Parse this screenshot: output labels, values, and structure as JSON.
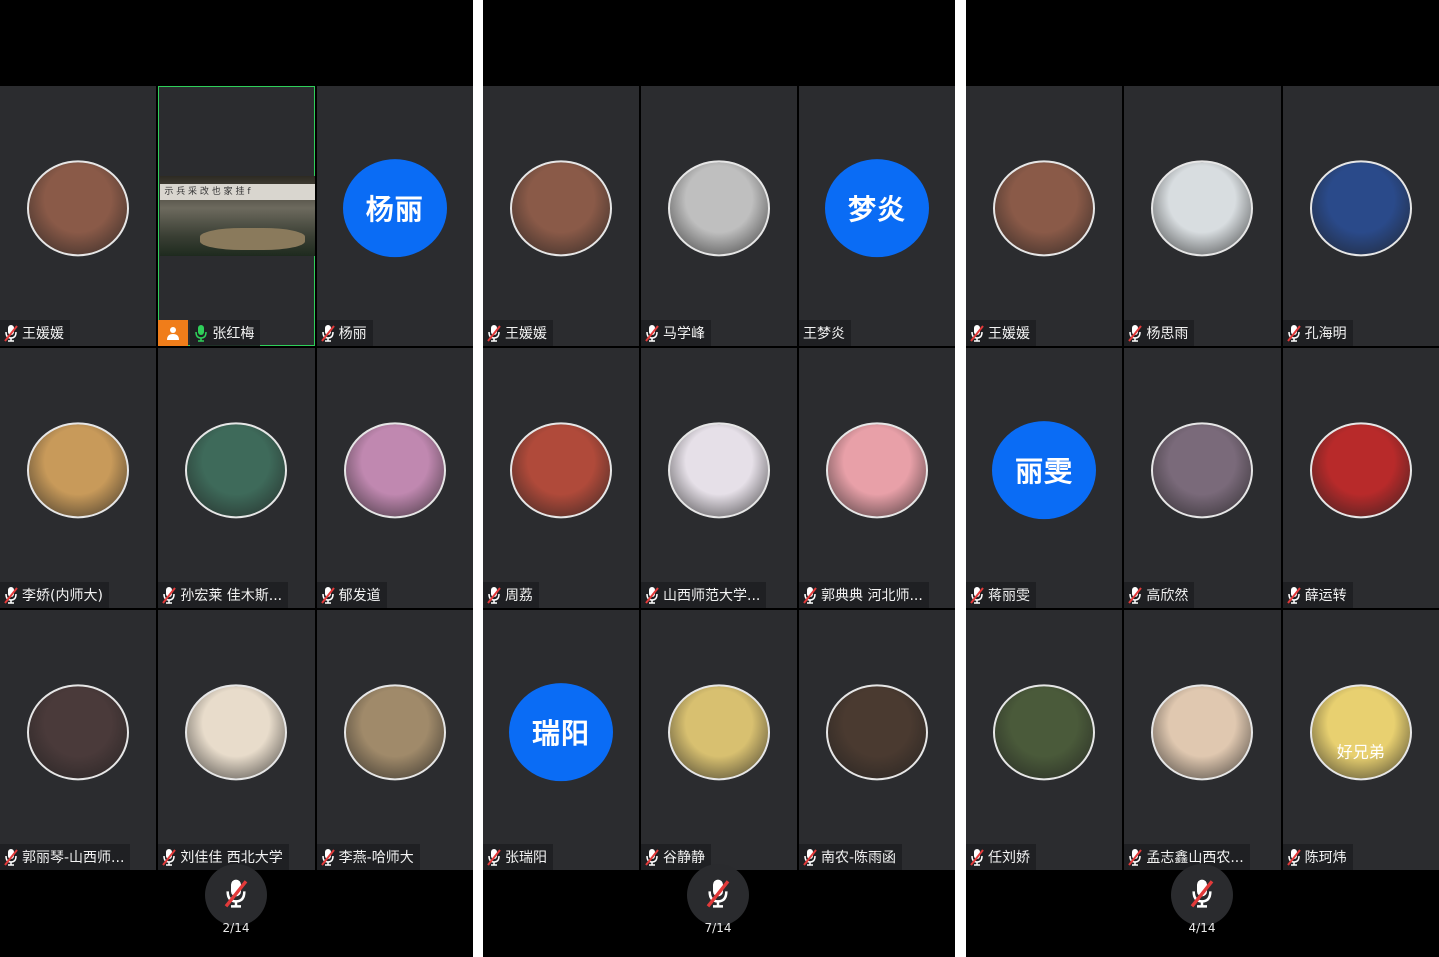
{
  "screens": [
    {
      "page": "2/14",
      "tiles": [
        {
          "name": "王媛媛",
          "mic": "muted",
          "avatar": "photo",
          "color": "#8a5a48"
        },
        {
          "name": "张红梅",
          "mic": "active",
          "avatar": "video",
          "host": true,
          "video_caption": "示 兵   采 改   也 家   挂 f"
        },
        {
          "name": "杨丽",
          "mic": "muted",
          "avatar": "text",
          "avatar_text": "杨丽"
        },
        {
          "name": "李娇(内师大)",
          "mic": "muted",
          "avatar": "photo",
          "color": "#c89a5a"
        },
        {
          "name": "孙宏莱 佳木斯...",
          "mic": "muted",
          "avatar": "photo",
          "color": "#3e6a5a"
        },
        {
          "name": "郁发道",
          "mic": "muted",
          "avatar": "photo",
          "color": "#c088b0"
        },
        {
          "name": "郭丽琴-山西师...",
          "mic": "muted",
          "avatar": "photo",
          "color": "#4a3a3a"
        },
        {
          "name": "刘佳佳 西北大学",
          "mic": "muted",
          "avatar": "photo",
          "color": "#e8dccb"
        },
        {
          "name": "李燕-哈师大",
          "mic": "muted",
          "avatar": "photo",
          "color": "#a08a6a"
        }
      ]
    },
    {
      "page": "7/14",
      "tiles": [
        {
          "name": "王媛媛",
          "mic": "muted",
          "avatar": "photo",
          "color": "#8a5a48"
        },
        {
          "name": "马学峰",
          "mic": "muted",
          "avatar": "photo",
          "color": "#bfbfbf"
        },
        {
          "name": "王梦炎",
          "mic": "none",
          "avatar": "text",
          "avatar_text": "梦炎"
        },
        {
          "name": "周荔",
          "mic": "muted",
          "avatar": "photo",
          "color": "#b04a3a"
        },
        {
          "name": "山西师范大学...",
          "mic": "muted",
          "avatar": "photo",
          "color": "#e6e0e8"
        },
        {
          "name": "郭典典 河北师...",
          "mic": "muted",
          "avatar": "photo",
          "color": "#e8a0a8"
        },
        {
          "name": "张瑞阳",
          "mic": "muted",
          "avatar": "text",
          "avatar_text": "瑞阳"
        },
        {
          "name": "谷静静",
          "mic": "muted",
          "avatar": "photo",
          "color": "#d8c070"
        },
        {
          "name": "南农-陈雨函",
          "mic": "muted",
          "avatar": "photo",
          "color": "#4a3a30"
        }
      ]
    },
    {
      "page": "4/14",
      "tiles": [
        {
          "name": "王媛媛",
          "mic": "muted",
          "avatar": "photo",
          "color": "#8a5a48"
        },
        {
          "name": "杨思雨",
          "mic": "muted",
          "avatar": "photo",
          "color": "#d8dde0"
        },
        {
          "name": "孔海明",
          "mic": "muted",
          "avatar": "photo",
          "color": "#2a4a8a"
        },
        {
          "name": "蒋丽雯",
          "mic": "muted",
          "avatar": "text",
          "avatar_text": "丽雯"
        },
        {
          "name": "高欣然",
          "mic": "muted",
          "avatar": "photo",
          "color": "#7a6a7a"
        },
        {
          "name": "薛运转",
          "mic": "muted",
          "avatar": "photo",
          "color": "#b82a2a"
        },
        {
          "name": "任刘娇",
          "mic": "muted",
          "avatar": "photo",
          "color": "#4a5a3a"
        },
        {
          "name": "孟志鑫山西农...",
          "mic": "muted",
          "avatar": "photo",
          "color": "#e0c8b0"
        },
        {
          "name": "陈珂炜",
          "mic": "muted",
          "avatar": "photo",
          "color": "#e8d070",
          "avatar_caption": "好兄弟"
        }
      ]
    }
  ],
  "colors": {
    "tile_bg": "#2b2c2f",
    "text_avatar": "#0a6cf5",
    "mic_muted": "#e23a3a",
    "mic_active": "#2fcf5a",
    "host_badge": "#f07d1a"
  }
}
